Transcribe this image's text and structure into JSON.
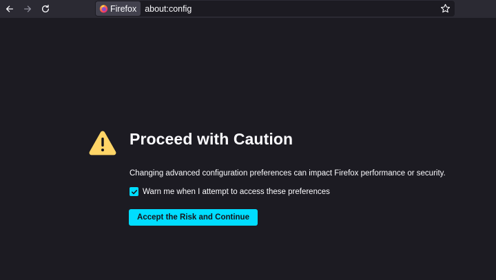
{
  "browser": {
    "identity_label": "Firefox",
    "url": "about:config",
    "icons": {
      "back": "back-arrow-icon",
      "forward": "forward-arrow-icon",
      "reload": "reload-icon",
      "identity": "firefox-logo-icon",
      "bookmark": "star-icon"
    }
  },
  "warning": {
    "icon": "warning-triangle-icon",
    "title": "Proceed with Caution",
    "description": "Changing advanced configuration preferences can impact Firefox performance or security.",
    "checkbox_label": "Warn me when I attempt to access these preferences",
    "checkbox_checked": true,
    "accept_button": "Accept the Risk and Continue"
  },
  "colors": {
    "background": "#1c1b22",
    "toolbar": "#2b2a33",
    "accent": "#00ddff",
    "warning": "#ffd567",
    "text": "#fbfbfe"
  }
}
